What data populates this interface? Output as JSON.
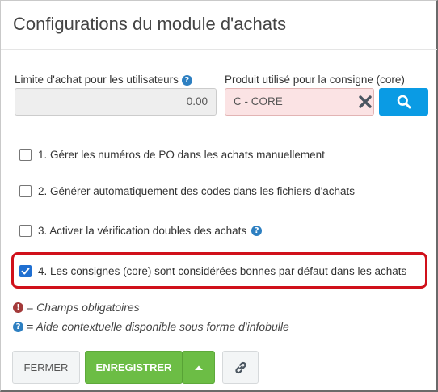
{
  "dialog": {
    "title": "Configurations du module d'achats"
  },
  "fields": {
    "limit_label": "Limite d'achat pour les utilisateurs",
    "limit_value": "0.00",
    "core_label": "Produit utilisé pour la consigne (core)",
    "core_value": "C - CORE"
  },
  "options": [
    {
      "label": "1. Gérer les numéros de PO dans les achats manuellement",
      "checked": false
    },
    {
      "label": "2. Générer automatiquement des codes dans les fichiers d'achats",
      "checked": false
    },
    {
      "label": "3. Activer la vérification doubles des achats",
      "checked": false
    },
    {
      "label": "4. Les consignes (core) sont considérées bonnes par défaut dans les achats",
      "checked": true
    }
  ],
  "legend": {
    "required": "= Champs obligatoires",
    "help": "= Aide contextuelle disponible sous forme d'infobulle"
  },
  "buttons": {
    "close": "FERMER",
    "save": "ENREGISTRER"
  },
  "icons": {
    "help": "?",
    "required": "!"
  },
  "colors": {
    "primary_blue": "#0a9be4",
    "save_green": "#6cbd45",
    "required_field_bg": "#fbe3e4",
    "highlight_red": "#d0101a"
  }
}
